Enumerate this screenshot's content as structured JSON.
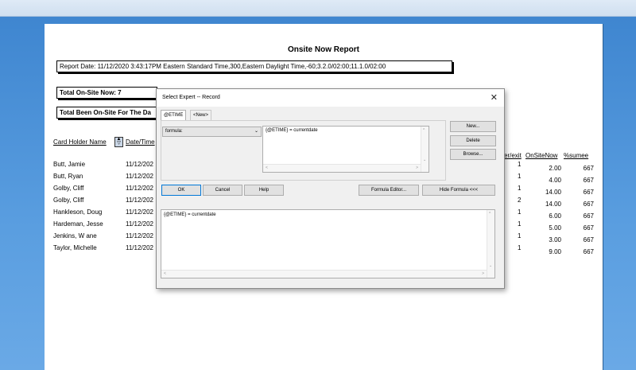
{
  "report": {
    "title": "Onsite Now Report",
    "report_date": "Report Date:  11/12/2020  3:43:17PM Eastern Standard Time,300,Eastern Daylight Time,-60;3.2.0/02:00;11.1.0/02:00",
    "total_onsite": "Total On-Site Now:  7",
    "total_been": "Total Been On-Site For The Da",
    "headers": {
      "card_holder": "Card Holder Name",
      "datetime": "Date/Time",
      "enter_exit": "er/exit",
      "onsitenow": "OnSiteNow",
      "sumee": "%sumee"
    },
    "rows": [
      {
        "name": "Butt,  Jamie",
        "date": "11/12/202",
        "ee": "1",
        "onsite": "2.00",
        "sum": "667"
      },
      {
        "name": "Butt,  Ryan",
        "date": "11/12/202",
        "ee": "1",
        "onsite": "4.00",
        "sum": "667"
      },
      {
        "name": "Golby,  Cliff",
        "date": "11/12/202",
        "ee": "1",
        "onsite": "14.00",
        "sum": "667"
      },
      {
        "name": "Golby,  Cliff",
        "date": "11/12/202",
        "ee": "2",
        "onsite": "14.00",
        "sum": "667"
      },
      {
        "name": "Hankleson,  Doug",
        "date": "11/12/202",
        "ee": "1",
        "onsite": "6.00",
        "sum": "667"
      },
      {
        "name": "Hardeman,  Jesse",
        "date": "11/12/202",
        "ee": "1",
        "onsite": "5.00",
        "sum": "667"
      },
      {
        "name": "Jenkins,  W ane",
        "date": "11/12/202",
        "ee": "1",
        "onsite": "3.00",
        "sum": "667"
      },
      {
        "name": "Taylor,  Michelle",
        "date": "11/12/202",
        "ee": "1",
        "onsite": "9.00",
        "sum": "667"
      }
    ]
  },
  "dialog": {
    "title": "Select Expert -- Record",
    "close": "✕",
    "tabs": [
      "@ETIME",
      "<New>"
    ],
    "select_value": "formula:",
    "formula_text": "{@ETIME} = currentdate",
    "side_buttons": {
      "new": "New...",
      "delete": "Delete",
      "browse": "Browse..."
    },
    "buttons": {
      "ok": "OK",
      "cancel": "Cancel",
      "help": "Help",
      "formula_editor": "Formula Editor...",
      "hide_formula": "Hide Formula <<<"
    },
    "bottom_formula": "{@ETIME} = currentdate"
  },
  "icons": {
    "sort": "sort-icon",
    "close": "close-icon",
    "chevron": "chevron-down-icon"
  }
}
